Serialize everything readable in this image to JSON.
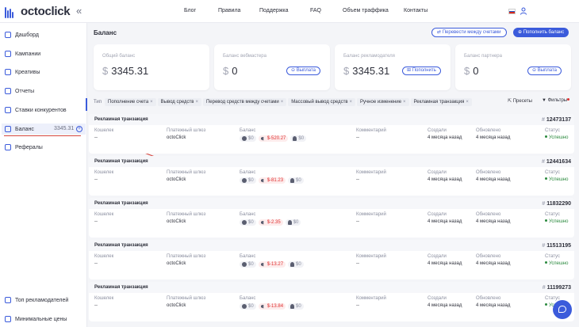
{
  "app": {
    "logo_text": "octoclick",
    "collapse_icon": "«"
  },
  "nav": [
    "Блог",
    "Правила",
    "Поддержка",
    "FAQ",
    "Объем траффика",
    "Контакты"
  ],
  "sidebar": {
    "items": [
      {
        "label": "Дашборд",
        "icon": "dashboard-icon"
      },
      {
        "label": "Кампании",
        "icon": "campaigns-icon"
      },
      {
        "label": "Креативы",
        "icon": "creatives-icon"
      },
      {
        "label": "Отчеты",
        "icon": "reports-icon"
      },
      {
        "label": "Ставки конкурентов",
        "icon": "bids-icon"
      },
      {
        "label": "Баланс",
        "icon": "balance-icon",
        "value": "3345.31"
      },
      {
        "label": "Рефералы",
        "icon": "referrals-icon"
      }
    ],
    "bottom": [
      {
        "label": "Топ рекламодателей",
        "icon": "top-icon"
      },
      {
        "label": "Минимальные цены",
        "icon": "prices-icon"
      }
    ]
  },
  "page": {
    "title": "Баланс",
    "transfer_button": "Перевести между счетами",
    "topup_button": "Пополнить баланс"
  },
  "cards": [
    {
      "label": "Общий баланс",
      "currency": "$",
      "value": "3345.31",
      "button": ""
    },
    {
      "label": "Баланс вебмастера",
      "currency": "$",
      "value": "0",
      "button": "Выплата"
    },
    {
      "label": "Баланс рекламодателя",
      "currency": "$",
      "value": "3345.31",
      "button": "Пополнить"
    },
    {
      "label": "Баланс партнера",
      "currency": "$",
      "value": "0",
      "button": "Выплата"
    }
  ],
  "filters": {
    "type_label": "Тип",
    "chips": [
      "Пополнение счета",
      "Вывод средств",
      "Перевод средств между счетами",
      "Массовый вывод средств",
      "Ручное изменение",
      "Рекламная транзакция"
    ],
    "presets": "Пресеты",
    "filters": "Фильтры"
  },
  "columns": {
    "wallet": "Кошелек",
    "gateway": "Платежный шлюз",
    "balance": "Баланс",
    "comment": "Комментарий",
    "created": "Создали",
    "updated": "Обновлено",
    "status": "Статус"
  },
  "transactions": [
    {
      "title": "Рекламная транзакция",
      "id": "12473137",
      "wallet": "--",
      "gateway": "octoClick",
      "b1": "$0",
      "b2": "$-520.27",
      "b3": "$0",
      "comment": "--",
      "created": "4 месяца назад",
      "updated": "4 месяца назад",
      "status": "Успешно"
    },
    {
      "title": "Рекламная транзакция",
      "id": "12441634",
      "wallet": "--",
      "gateway": "octoClick",
      "b1": "$0",
      "b2": "$-81.23",
      "b3": "$0",
      "comment": "--",
      "created": "4 месяца назад",
      "updated": "4 месяца назад",
      "status": "Успешно"
    },
    {
      "title": "Рекламная транзакция",
      "id": "11832290",
      "wallet": "--",
      "gateway": "octoClick",
      "b1": "$0",
      "b2": "$-2.35",
      "b3": "$0",
      "comment": "--",
      "created": "4 месяца назад",
      "updated": "4 месяца назад",
      "status": "Успешно"
    },
    {
      "title": "Рекламная транзакция",
      "id": "11513195",
      "wallet": "--",
      "gateway": "octoClick",
      "b1": "$0",
      "b2": "$-13.27",
      "b3": "$0",
      "comment": "--",
      "created": "4 месяца назад",
      "updated": "4 месяца назад",
      "status": "Успешно"
    },
    {
      "title": "Рекламная транзакция",
      "id": "11199273",
      "wallet": "--",
      "gateway": "octoClick",
      "b1": "$0",
      "b2": "$-13.84",
      "b3": "$0",
      "comment": "--",
      "created": "4 месяца назад",
      "updated": "4 месяца назад",
      "status": "Успешно"
    }
  ],
  "colors": {
    "accent": "#3b5bdb",
    "negative": "#e03131",
    "success": "#2b8a3e",
    "annotation": "#d6453d"
  }
}
